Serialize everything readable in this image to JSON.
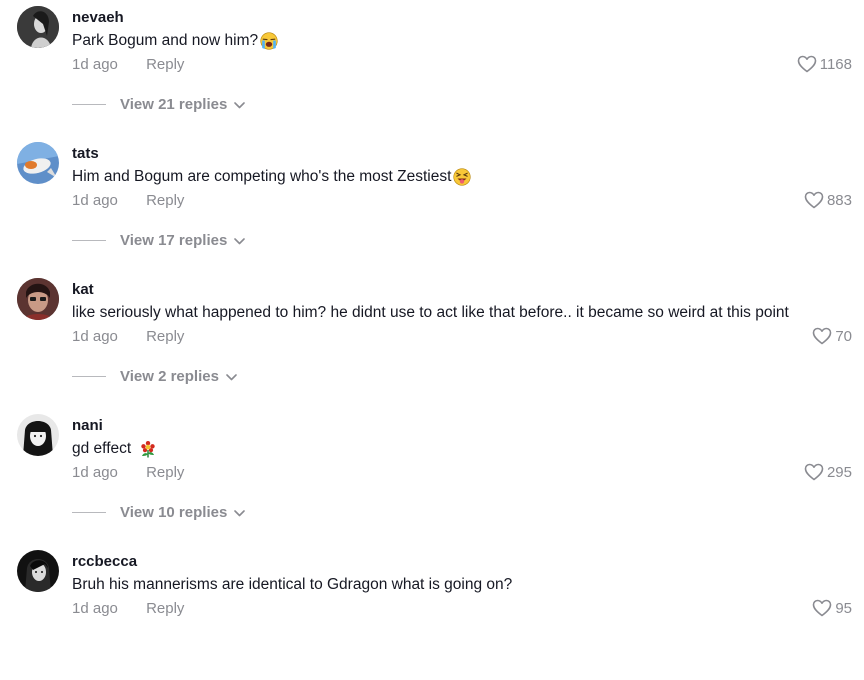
{
  "comments": [
    {
      "username": "nevaeh",
      "text": "Park Bogum and now him?",
      "emoji": "loudly-crying-face-icon",
      "time": "1d ago",
      "reply_label": "Reply",
      "likes": "1168",
      "view_replies": "View 21 replies"
    },
    {
      "username": "tats",
      "text": "Him and Bogum are competing who's the most Zestiest",
      "emoji": "squinting-tongue-face-icon",
      "time": "1d ago",
      "reply_label": "Reply",
      "likes": "883",
      "view_replies": "View 17 replies"
    },
    {
      "username": "kat",
      "text": "like seriously what happened to him? he didnt use to act like that before.. it became so weird at this point",
      "emoji": "",
      "time": "1d ago",
      "reply_label": "Reply",
      "likes": "70",
      "view_replies": "View 2 replies"
    },
    {
      "username": "nani",
      "text": "gd effect",
      "emoji": "daisy-flower-icon",
      "time": "1d ago",
      "reply_label": "Reply",
      "likes": "295",
      "view_replies": "View 10 replies"
    },
    {
      "username": "rccbecca",
      "text": "Bruh his mannerisms are identical to Gdragon what is going on?",
      "emoji": "",
      "time": "1d ago",
      "reply_label": "Reply",
      "likes": "95",
      "view_replies": ""
    }
  ],
  "colors": {
    "text_primary": "#161823",
    "text_secondary": "#8a8b91"
  }
}
